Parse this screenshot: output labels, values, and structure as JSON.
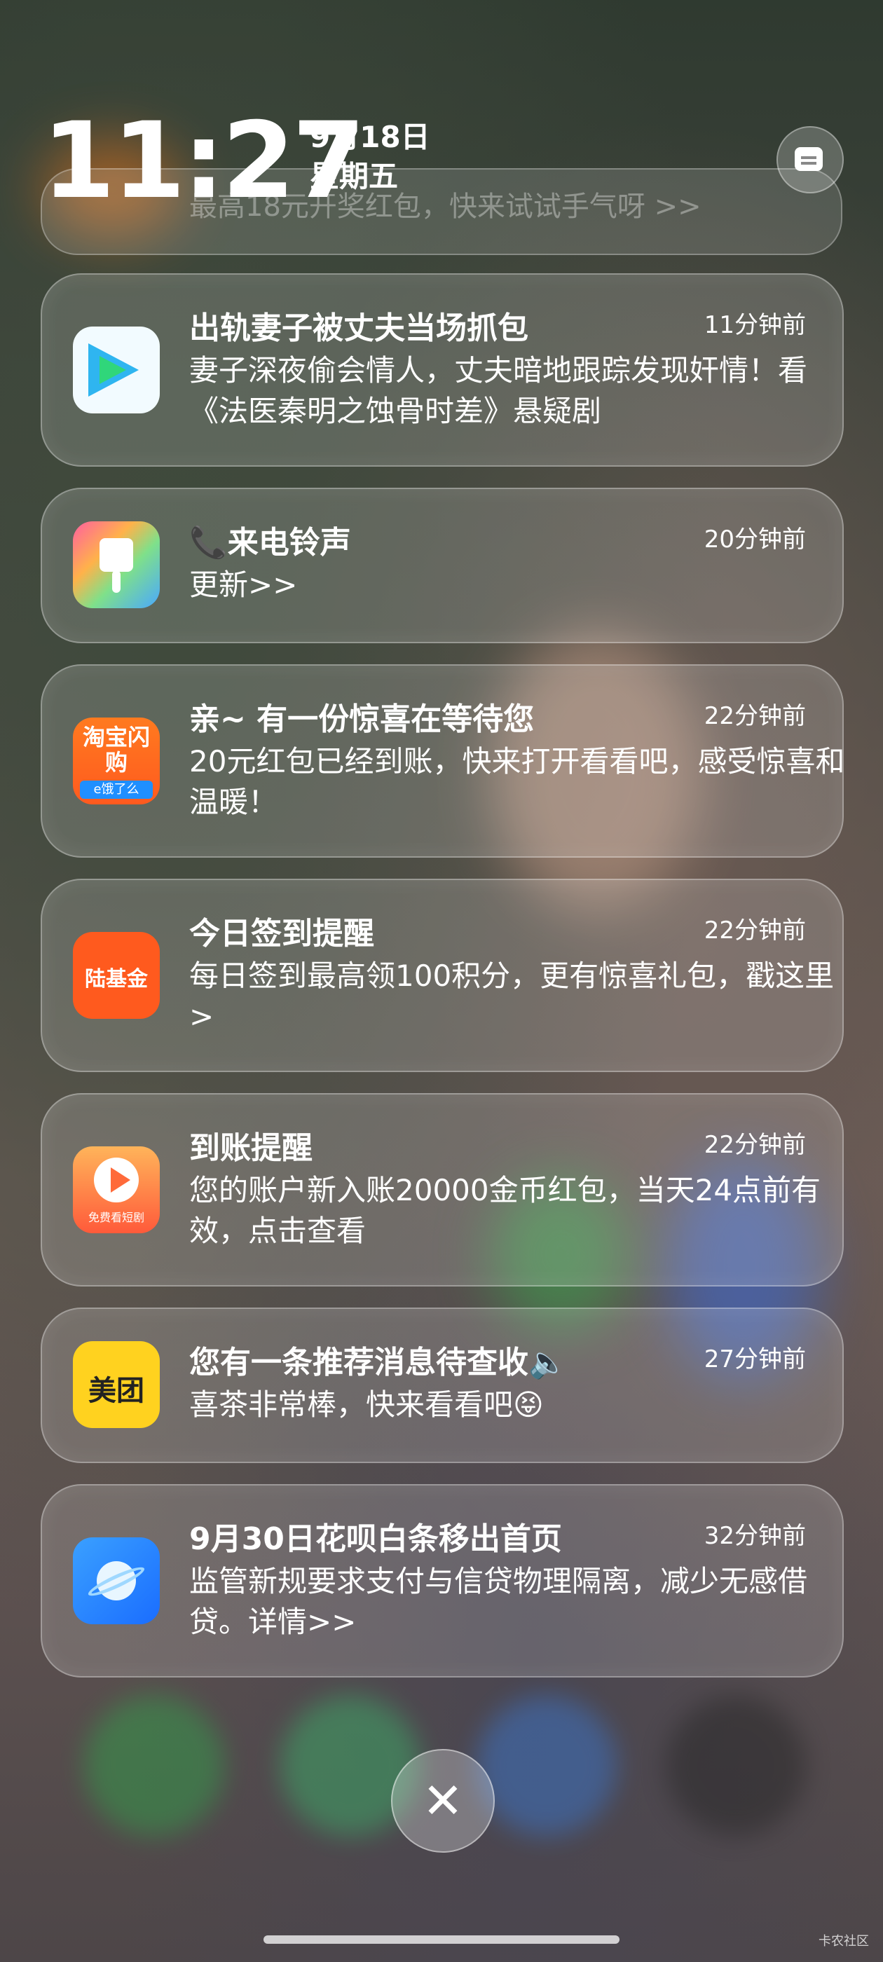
{
  "status": {
    "time": "11:27",
    "date": "9月18日",
    "weekday": "星期五"
  },
  "stub_notification": {
    "body": "最高18元开奖红包，快来试试手气呀 >>"
  },
  "notifications": [
    {
      "app_icon": "tencent-video-icon",
      "title": "出轨妻子被丈夫当场抓包",
      "time": "11分钟前",
      "body": "妻子深夜偷会情人，丈夫暗地跟踪发现奸情！看《法医秦明之蚀骨时差》悬疑剧"
    },
    {
      "app_icon": "ringtone-icon",
      "title": "📞来电铃声",
      "time": "20分钟前",
      "body": "更新>>"
    },
    {
      "app_icon": "taobao-flash-icon",
      "icon_text": "淘宝闪购",
      "icon_sub": "e饿了么",
      "title": "亲~ 有一份惊喜在等待您",
      "time": "22分钟前",
      "body": "20元红包已经到账，快来打开看看吧，感受惊喜和温暖！"
    },
    {
      "app_icon": "lufax-icon",
      "icon_text": "陆基金",
      "title": "今日签到提醒",
      "time": "22分钟前",
      "body": "每日签到最高领100积分，更有惊喜礼包，戳这里>"
    },
    {
      "app_icon": "free-drama-icon",
      "icon_sub": "免费看短剧",
      "title": "到账提醒",
      "time": "22分钟前",
      "body": "您的账户新入账20000金币红包，当天24点前有效，点击查看"
    },
    {
      "app_icon": "meituan-icon",
      "icon_text": "美团",
      "title": "您有一条推荐消息待查收🔈",
      "time": "27分钟前",
      "body": "喜茶非常棒，快来看看吧😝"
    },
    {
      "app_icon": "browser-icon",
      "title": "9月30日花呗白条移出首页",
      "time": "32分钟前",
      "body": "监管新规要求支付与信贷物理隔离，减少无感借贷。详情>>"
    }
  ],
  "controls": {
    "close_glyph": "✕"
  },
  "watermark": "卡农社区"
}
